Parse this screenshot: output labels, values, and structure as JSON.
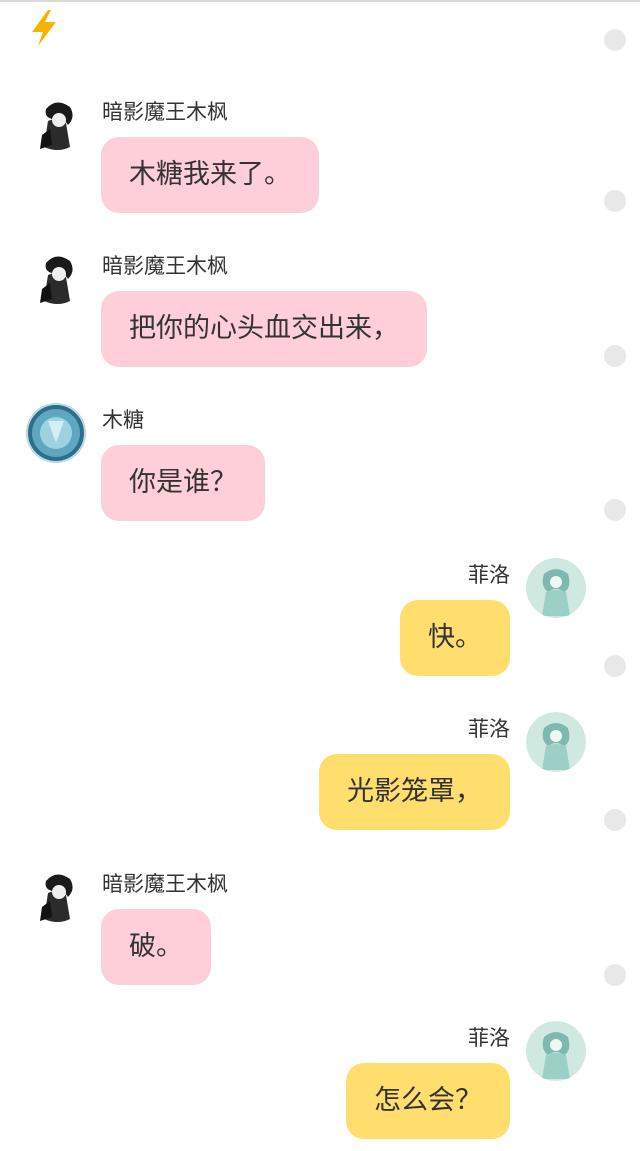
{
  "colors": {
    "pink_bubble": "#ffcfd9",
    "yellow_bubble": "#ffde6e",
    "bolt": "#f5b400"
  },
  "header": {
    "icon": "lightning-icon"
  },
  "messages": [
    {
      "side": "left",
      "sender": "暗影魔王木枫",
      "avatar": "dark-character-avatar",
      "text": "木糖我来了。"
    },
    {
      "side": "left",
      "sender": "暗影魔王木枫",
      "avatar": "dark-character-avatar",
      "text": "把你的心头血交出来，"
    },
    {
      "side": "left",
      "sender": "木糖",
      "avatar": "blue-crystal-avatar",
      "text": "你是谁？"
    },
    {
      "side": "right",
      "sender": "菲洛",
      "avatar": "teal-character-avatar",
      "text": "快。"
    },
    {
      "side": "right",
      "sender": "菲洛",
      "avatar": "teal-character-avatar",
      "text": "光影笼罩，"
    },
    {
      "side": "left",
      "sender": "暗影魔王木枫",
      "avatar": "dark-character-avatar",
      "text": "破。"
    },
    {
      "side": "right",
      "sender": "菲洛",
      "avatar": "teal-character-avatar",
      "text": "怎么会？"
    }
  ]
}
